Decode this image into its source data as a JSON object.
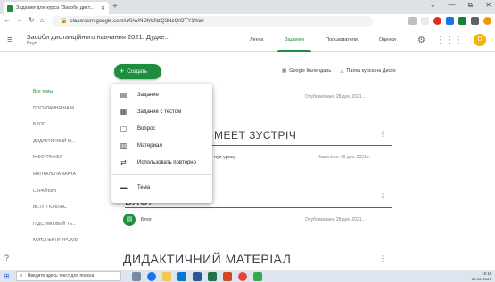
{
  "browser": {
    "tab_title": "Задания для курса \"Засоби дист...",
    "new_tab": "+",
    "url": "classroom.google.com/u/0/w/NDMxNzQ3NzQ/OTY1/t/all",
    "window_controls": [
      "⌄",
      "—",
      "⧉",
      "✕"
    ]
  },
  "header": {
    "menu_icon": "≡",
    "course_name": "Засоби дистанційного навчання 2021. Дудке...",
    "course_section": "Втуп",
    "tabs": [
      "Лента",
      "Задания",
      "Пользователи",
      "Оценки"
    ],
    "active_tab_index": 1,
    "avatar_letter": "D"
  },
  "toolbar": {
    "create_label": "Создать",
    "calendar_label": "Google Календарь",
    "drive_label": "Папка курса на Диске"
  },
  "topics": [
    "Все темы",
    "ПОСИЛАННЯ НА М...",
    "БЛОГ",
    "ДИДАКТИЧНИЙ М...",
    "ІНФОГРАФІКА",
    "МЕНТАЛЬНА КАРТА",
    "СКРАЙБІНГ",
    "ВСТУП ІО КЛАС",
    "ПІДСУМКОВИЙ ТЕ...",
    "КОНСПЕКТИ УРОКІВ"
  ],
  "menu": {
    "items": [
      {
        "icon": "assignment-icon",
        "glyph": "▤",
        "label": "Задание"
      },
      {
        "icon": "quiz-assignment-icon",
        "glyph": "▦",
        "label": "Задание с тестом"
      },
      {
        "icon": "question-icon",
        "glyph": "▢",
        "label": "Вопрос"
      },
      {
        "icon": "material-icon",
        "glyph": "▥",
        "label": "Материал"
      },
      {
        "icon": "reuse-post-icon",
        "glyph": "⇄",
        "label": "Использовать повторно"
      },
      {
        "icon": "topic-icon",
        "glyph": "▬",
        "label": "Тема"
      }
    ]
  },
  "content": {
    "row1_date": "Опубликовано 28 дек. 2021...",
    "section1_title": "МЕЕТ ЗУСТРІЧ",
    "row2_text": "пуя уроку",
    "row2_date": "Изменено: 29 дек. 2021 г.",
    "section2_title": "БЛОГ",
    "blog_item": "Блог",
    "blog_date": "Опубликовано 28 дек. 2021...",
    "section3_title": "ДИДАКТИЧНИЙ МАТЕРІАЛ"
  },
  "taskbar": {
    "search_placeholder": "Введите здесь текст для поиска",
    "time": "15:11",
    "date": "29.12.2021"
  },
  "colors": {
    "accent": "#1e8e3e",
    "taskbar": "#dfe5ee"
  }
}
